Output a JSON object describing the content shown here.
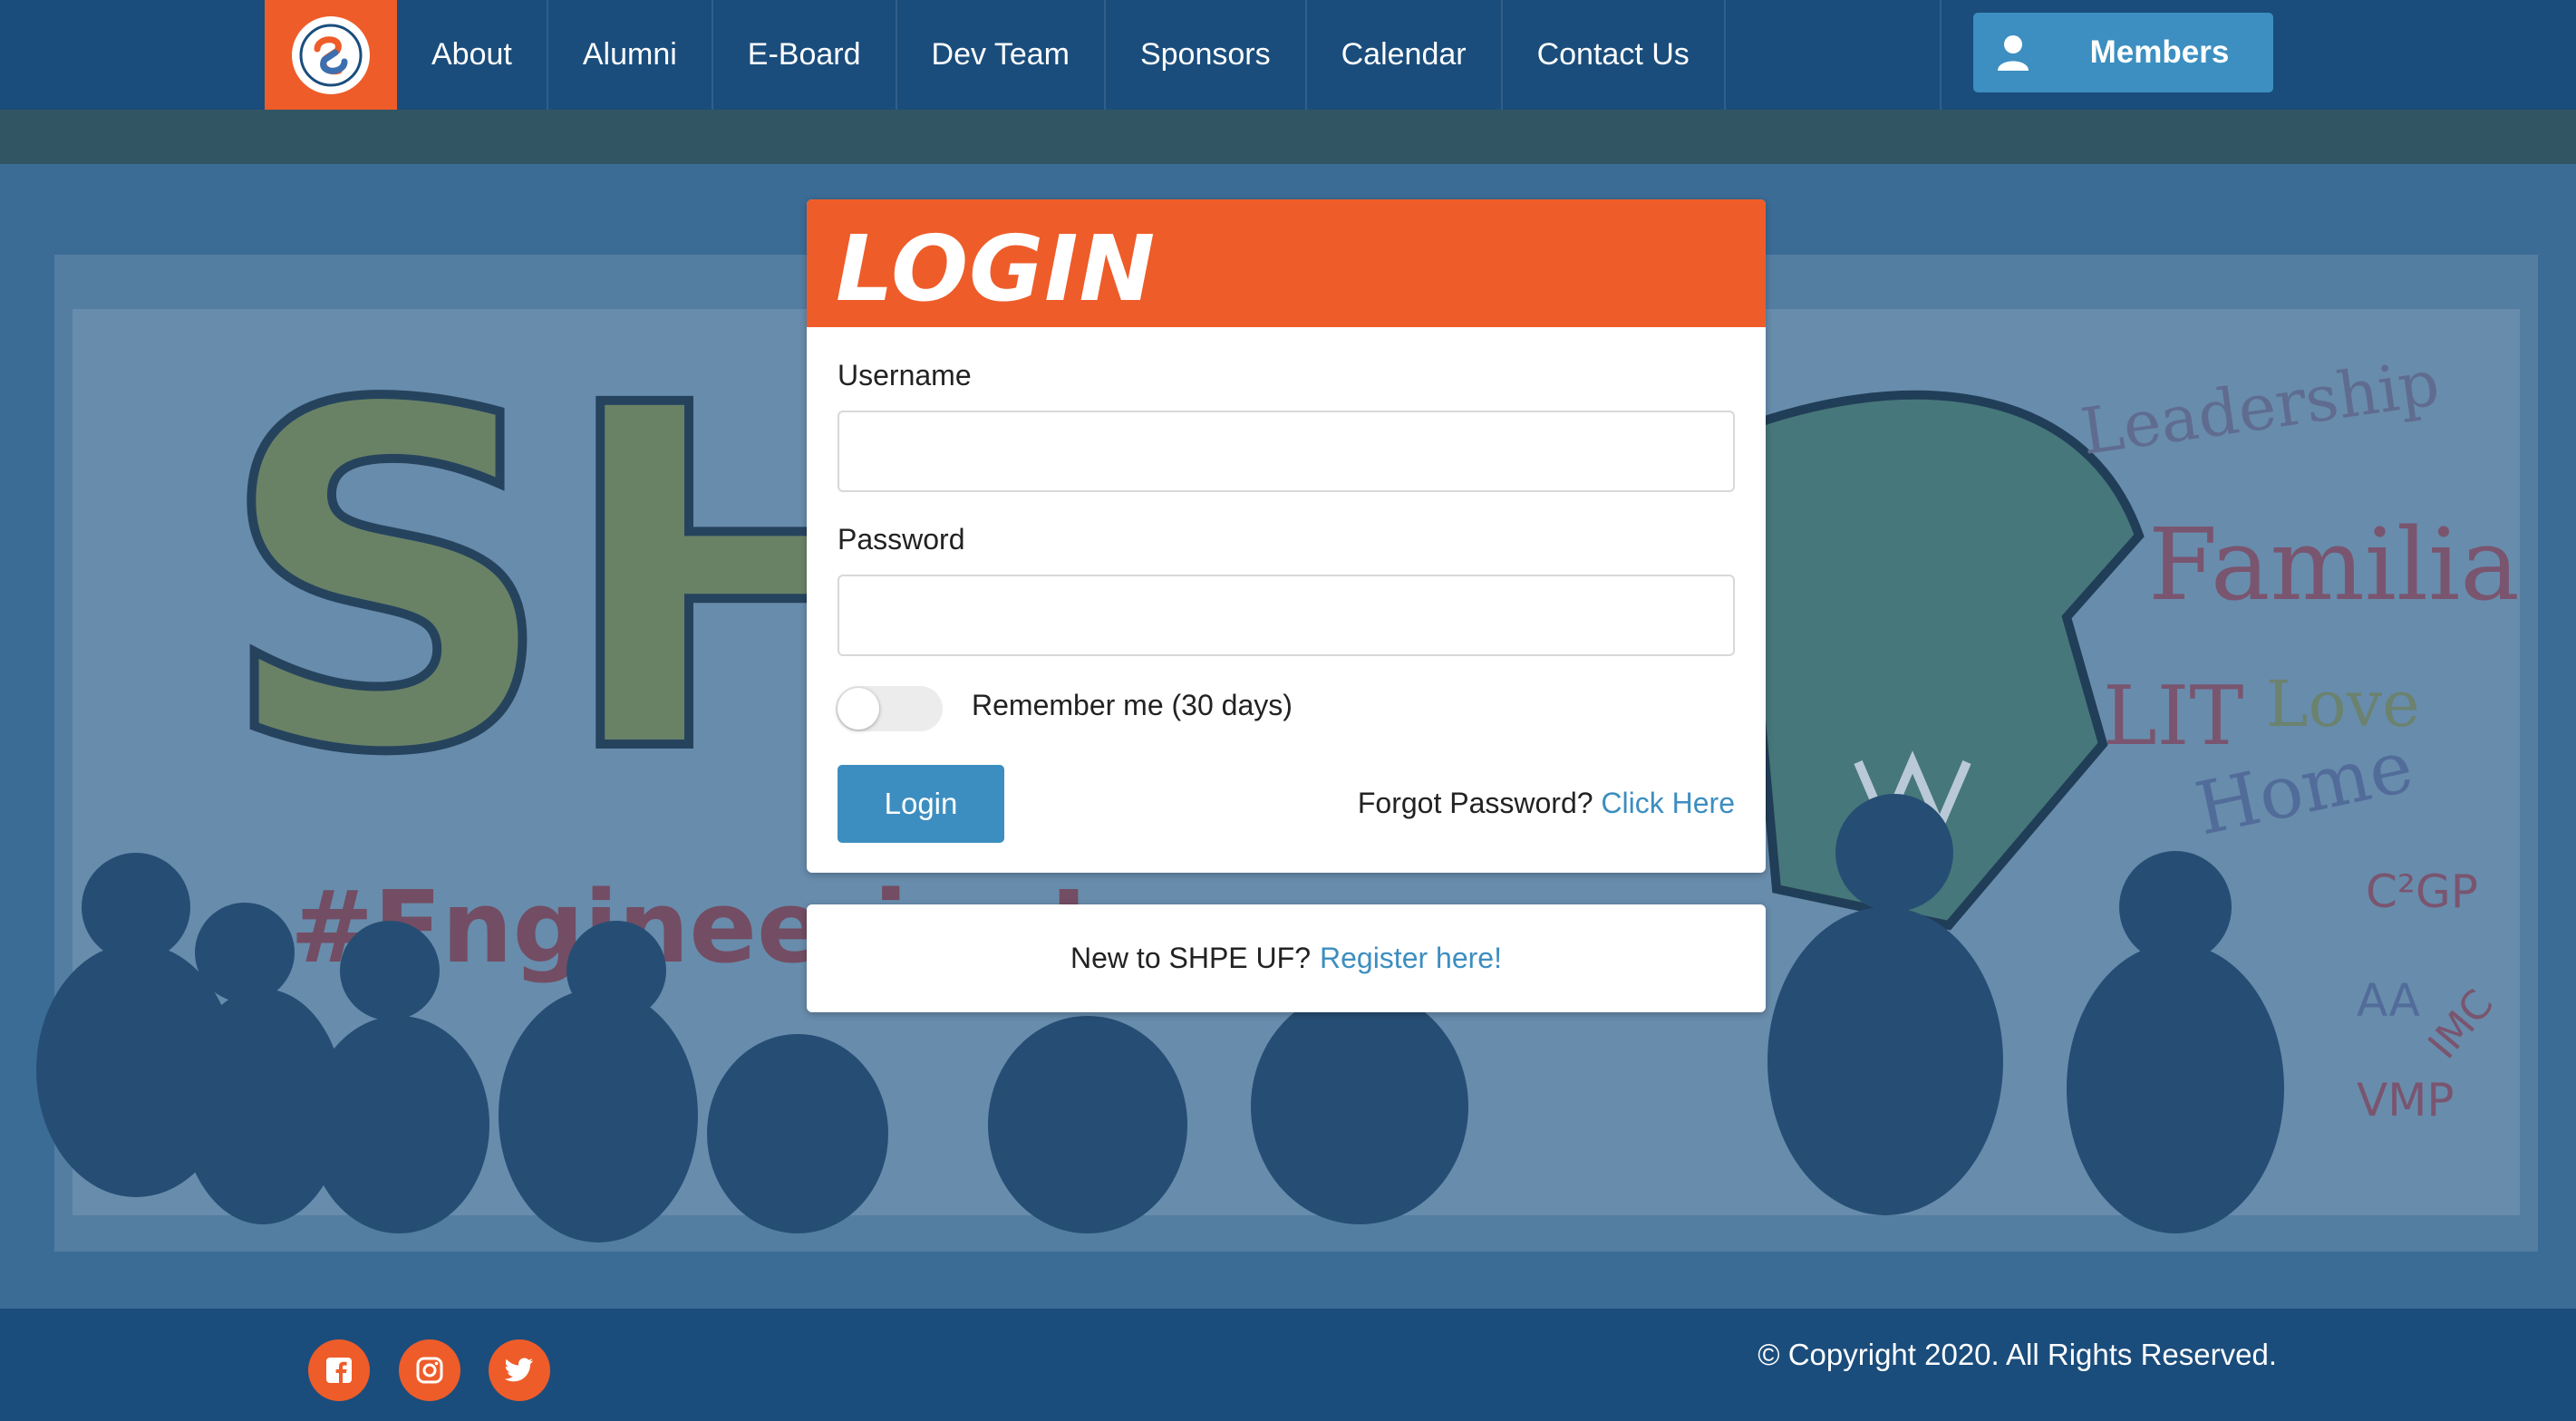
{
  "nav": {
    "items": [
      {
        "label": "About"
      },
      {
        "label": "Alumni"
      },
      {
        "label": "E-Board"
      },
      {
        "label": "Dev Team"
      },
      {
        "label": "Sponsors"
      },
      {
        "label": "Calendar"
      },
      {
        "label": "Contact Us"
      }
    ],
    "members_label": "Members"
  },
  "hero": {
    "mural_text": "SH",
    "hashtag_text": "#EngineeringLegacy",
    "mural_words": [
      "Leadership",
      "Familia",
      "LIT",
      "Love",
      "Home",
      "C²GP",
      "VMP",
      "AA",
      "IMC"
    ]
  },
  "login": {
    "title": "LOGIN",
    "username_label": "Username",
    "username_value": "",
    "password_label": "Password",
    "password_value": "",
    "remember_label": "Remember me (30 days)",
    "remember_on": false,
    "login_button": "Login",
    "forgot_text": "Forgot Password?",
    "forgot_link": "Click Here"
  },
  "register": {
    "text": "New to SHPE UF?",
    "link": "Register here!"
  },
  "footer": {
    "social": [
      "facebook-icon",
      "instagram-icon",
      "twitter-icon"
    ],
    "copyright": "© Copyright 2020. All Rights Reserved."
  },
  "colors": {
    "nav_bg": "#1a4d7c",
    "accent_orange": "#ee5c2a",
    "button_blue": "#3d8ec0",
    "link_blue": "#3d8ec0"
  }
}
